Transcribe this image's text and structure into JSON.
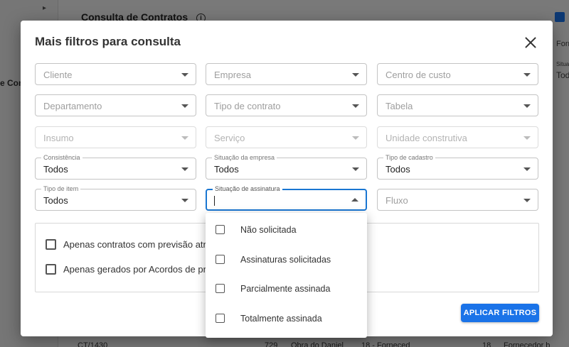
{
  "background": {
    "page_title": "Consulta de Contratos",
    "info_icon": "i",
    "partial_left_text": "e Com",
    "right_partial": {
      "header_a": "Forn",
      "header_b": "Situa",
      "header_c": "Tod"
    },
    "bottom_row": {
      "code": "CT/1430",
      "number": "729",
      "work": "Obra do Daniel",
      "supplier_code": "18 - Forneced",
      "num2": "18",
      "supplier": "Fornecedor b"
    }
  },
  "modal": {
    "title": "Mais filtros para consulta",
    "fields": {
      "cliente": {
        "placeholder": "Cliente"
      },
      "empresa": {
        "placeholder": "Empresa"
      },
      "centro_custo": {
        "placeholder": "Centro de custo"
      },
      "departamento": {
        "placeholder": "Departamento"
      },
      "tipo_contrato": {
        "placeholder": "Tipo de contrato"
      },
      "tabela": {
        "placeholder": "Tabela"
      },
      "insumo": {
        "placeholder": "Insumo"
      },
      "servico": {
        "placeholder": "Serviço"
      },
      "unidade": {
        "placeholder": "Unidade construtiva"
      },
      "consistencia": {
        "label": "Consistência",
        "value": "Todos"
      },
      "situacao_empresa": {
        "label": "Situação da empresa",
        "value": "Todos"
      },
      "tipo_cadastro": {
        "label": "Tipo de cadastro",
        "value": "Todos"
      },
      "tipo_item": {
        "label": "Tipo de item",
        "value": "Todos"
      },
      "situacao_assinatura": {
        "label": "Situação de assinatura",
        "value": ""
      },
      "fluxo": {
        "placeholder": "Fluxo"
      }
    },
    "checkboxes": {
      "previsao_atrasada": "Apenas contratos com previsão atrasa",
      "acordos_preco": "Apenas gerados por Acordos de preço"
    },
    "apply_label": "APLICAR FILTROS"
  },
  "signature_menu": {
    "options": [
      "Não solicitada",
      "Assinaturas solicitadas",
      "Parcialmente assinada",
      "Totalmente assinada"
    ]
  },
  "colors": {
    "accent": "#1a73e8",
    "focus_border": "#1976d2"
  }
}
